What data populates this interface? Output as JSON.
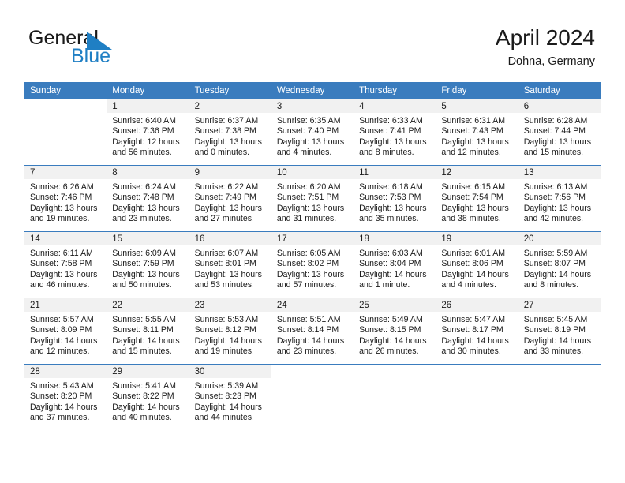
{
  "brand": {
    "word_general": "General",
    "word_blue": "Blue",
    "triangle_color": "#1f7fc4",
    "blue_text_color": "#1f7fc4"
  },
  "header": {
    "title": "April 2024",
    "subtitle": "Dohna, Germany",
    "header_bg": "#3a7cbe",
    "datenum_bg": "#f1f1f1"
  },
  "weekdays": [
    "Sunday",
    "Monday",
    "Tuesday",
    "Wednesday",
    "Thursday",
    "Friday",
    "Saturday"
  ],
  "weeks": [
    [
      {
        "day": "",
        "sunrise": "",
        "sunset": "",
        "daylight_line1": "",
        "daylight_line2": ""
      },
      {
        "day": "1",
        "sunrise": "Sunrise: 6:40 AM",
        "sunset": "Sunset: 7:36 PM",
        "daylight_line1": "Daylight: 12 hours",
        "daylight_line2": "and 56 minutes."
      },
      {
        "day": "2",
        "sunrise": "Sunrise: 6:37 AM",
        "sunset": "Sunset: 7:38 PM",
        "daylight_line1": "Daylight: 13 hours",
        "daylight_line2": "and 0 minutes."
      },
      {
        "day": "3",
        "sunrise": "Sunrise: 6:35 AM",
        "sunset": "Sunset: 7:40 PM",
        "daylight_line1": "Daylight: 13 hours",
        "daylight_line2": "and 4 minutes."
      },
      {
        "day": "4",
        "sunrise": "Sunrise: 6:33 AM",
        "sunset": "Sunset: 7:41 PM",
        "daylight_line1": "Daylight: 13 hours",
        "daylight_line2": "and 8 minutes."
      },
      {
        "day": "5",
        "sunrise": "Sunrise: 6:31 AM",
        "sunset": "Sunset: 7:43 PM",
        "daylight_line1": "Daylight: 13 hours",
        "daylight_line2": "and 12 minutes."
      },
      {
        "day": "6",
        "sunrise": "Sunrise: 6:28 AM",
        "sunset": "Sunset: 7:44 PM",
        "daylight_line1": "Daylight: 13 hours",
        "daylight_line2": "and 15 minutes."
      }
    ],
    [
      {
        "day": "7",
        "sunrise": "Sunrise: 6:26 AM",
        "sunset": "Sunset: 7:46 PM",
        "daylight_line1": "Daylight: 13 hours",
        "daylight_line2": "and 19 minutes."
      },
      {
        "day": "8",
        "sunrise": "Sunrise: 6:24 AM",
        "sunset": "Sunset: 7:48 PM",
        "daylight_line1": "Daylight: 13 hours",
        "daylight_line2": "and 23 minutes."
      },
      {
        "day": "9",
        "sunrise": "Sunrise: 6:22 AM",
        "sunset": "Sunset: 7:49 PM",
        "daylight_line1": "Daylight: 13 hours",
        "daylight_line2": "and 27 minutes."
      },
      {
        "day": "10",
        "sunrise": "Sunrise: 6:20 AM",
        "sunset": "Sunset: 7:51 PM",
        "daylight_line1": "Daylight: 13 hours",
        "daylight_line2": "and 31 minutes."
      },
      {
        "day": "11",
        "sunrise": "Sunrise: 6:18 AM",
        "sunset": "Sunset: 7:53 PM",
        "daylight_line1": "Daylight: 13 hours",
        "daylight_line2": "and 35 minutes."
      },
      {
        "day": "12",
        "sunrise": "Sunrise: 6:15 AM",
        "sunset": "Sunset: 7:54 PM",
        "daylight_line1": "Daylight: 13 hours",
        "daylight_line2": "and 38 minutes."
      },
      {
        "day": "13",
        "sunrise": "Sunrise: 6:13 AM",
        "sunset": "Sunset: 7:56 PM",
        "daylight_line1": "Daylight: 13 hours",
        "daylight_line2": "and 42 minutes."
      }
    ],
    [
      {
        "day": "14",
        "sunrise": "Sunrise: 6:11 AM",
        "sunset": "Sunset: 7:58 PM",
        "daylight_line1": "Daylight: 13 hours",
        "daylight_line2": "and 46 minutes."
      },
      {
        "day": "15",
        "sunrise": "Sunrise: 6:09 AM",
        "sunset": "Sunset: 7:59 PM",
        "daylight_line1": "Daylight: 13 hours",
        "daylight_line2": "and 50 minutes."
      },
      {
        "day": "16",
        "sunrise": "Sunrise: 6:07 AM",
        "sunset": "Sunset: 8:01 PM",
        "daylight_line1": "Daylight: 13 hours",
        "daylight_line2": "and 53 minutes."
      },
      {
        "day": "17",
        "sunrise": "Sunrise: 6:05 AM",
        "sunset": "Sunset: 8:02 PM",
        "daylight_line1": "Daylight: 13 hours",
        "daylight_line2": "and 57 minutes."
      },
      {
        "day": "18",
        "sunrise": "Sunrise: 6:03 AM",
        "sunset": "Sunset: 8:04 PM",
        "daylight_line1": "Daylight: 14 hours",
        "daylight_line2": "and 1 minute."
      },
      {
        "day": "19",
        "sunrise": "Sunrise: 6:01 AM",
        "sunset": "Sunset: 8:06 PM",
        "daylight_line1": "Daylight: 14 hours",
        "daylight_line2": "and 4 minutes."
      },
      {
        "day": "20",
        "sunrise": "Sunrise: 5:59 AM",
        "sunset": "Sunset: 8:07 PM",
        "daylight_line1": "Daylight: 14 hours",
        "daylight_line2": "and 8 minutes."
      }
    ],
    [
      {
        "day": "21",
        "sunrise": "Sunrise: 5:57 AM",
        "sunset": "Sunset: 8:09 PM",
        "daylight_line1": "Daylight: 14 hours",
        "daylight_line2": "and 12 minutes."
      },
      {
        "day": "22",
        "sunrise": "Sunrise: 5:55 AM",
        "sunset": "Sunset: 8:11 PM",
        "daylight_line1": "Daylight: 14 hours",
        "daylight_line2": "and 15 minutes."
      },
      {
        "day": "23",
        "sunrise": "Sunrise: 5:53 AM",
        "sunset": "Sunset: 8:12 PM",
        "daylight_line1": "Daylight: 14 hours",
        "daylight_line2": "and 19 minutes."
      },
      {
        "day": "24",
        "sunrise": "Sunrise: 5:51 AM",
        "sunset": "Sunset: 8:14 PM",
        "daylight_line1": "Daylight: 14 hours",
        "daylight_line2": "and 23 minutes."
      },
      {
        "day": "25",
        "sunrise": "Sunrise: 5:49 AM",
        "sunset": "Sunset: 8:15 PM",
        "daylight_line1": "Daylight: 14 hours",
        "daylight_line2": "and 26 minutes."
      },
      {
        "day": "26",
        "sunrise": "Sunrise: 5:47 AM",
        "sunset": "Sunset: 8:17 PM",
        "daylight_line1": "Daylight: 14 hours",
        "daylight_line2": "and 30 minutes."
      },
      {
        "day": "27",
        "sunrise": "Sunrise: 5:45 AM",
        "sunset": "Sunset: 8:19 PM",
        "daylight_line1": "Daylight: 14 hours",
        "daylight_line2": "and 33 minutes."
      }
    ],
    [
      {
        "day": "28",
        "sunrise": "Sunrise: 5:43 AM",
        "sunset": "Sunset: 8:20 PM",
        "daylight_line1": "Daylight: 14 hours",
        "daylight_line2": "and 37 minutes."
      },
      {
        "day": "29",
        "sunrise": "Sunrise: 5:41 AM",
        "sunset": "Sunset: 8:22 PM",
        "daylight_line1": "Daylight: 14 hours",
        "daylight_line2": "and 40 minutes."
      },
      {
        "day": "30",
        "sunrise": "Sunrise: 5:39 AM",
        "sunset": "Sunset: 8:23 PM",
        "daylight_line1": "Daylight: 14 hours",
        "daylight_line2": "and 44 minutes."
      },
      {
        "day": "",
        "sunrise": "",
        "sunset": "",
        "daylight_line1": "",
        "daylight_line2": ""
      },
      {
        "day": "",
        "sunrise": "",
        "sunset": "",
        "daylight_line1": "",
        "daylight_line2": ""
      },
      {
        "day": "",
        "sunrise": "",
        "sunset": "",
        "daylight_line1": "",
        "daylight_line2": ""
      },
      {
        "day": "",
        "sunrise": "",
        "sunset": "",
        "daylight_line1": "",
        "daylight_line2": ""
      }
    ]
  ]
}
